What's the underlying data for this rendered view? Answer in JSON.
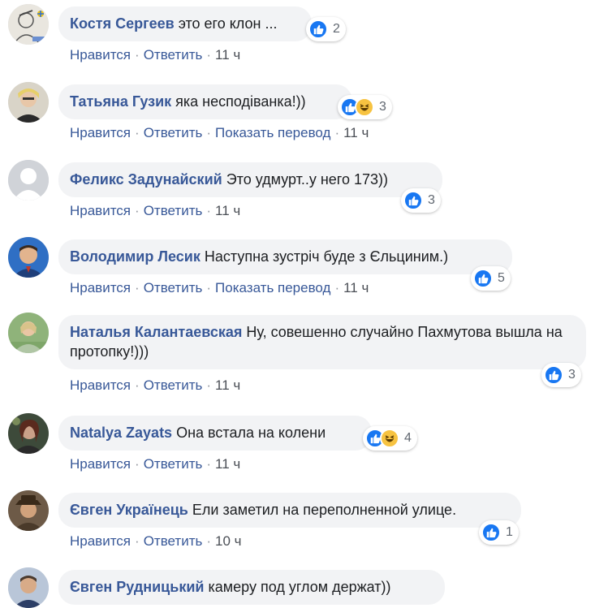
{
  "actions": {
    "like": "Нравится",
    "reply": "Ответить",
    "translate": "Показать перевод",
    "separator": "·"
  },
  "colors": {
    "link": "#385898",
    "bubble": "#f2f3f5",
    "like": "#1877f2",
    "haha": "#f7c341"
  },
  "comments": [
    {
      "author": "Костя Сергеев",
      "text": "это его клон ...",
      "reactions": [
        "like-icon"
      ],
      "count": "2",
      "translate": false,
      "time": "11 ч"
    },
    {
      "author": "Татьяна Гузик",
      "text": "яка несподіванка!))",
      "reactions": [
        "like-icon",
        "haha-icon"
      ],
      "count": "3",
      "translate": true,
      "time": "11 ч"
    },
    {
      "author": "Феликс Задунайский",
      "text": "Это удмурт..у него 173))",
      "reactions": [
        "like-icon"
      ],
      "count": "3",
      "translate": false,
      "time": "11 ч"
    },
    {
      "author": "Володимир Лесик",
      "text": "Наступна зустріч буде з Єльциним.)",
      "reactions": [
        "like-icon"
      ],
      "count": "5",
      "translate": true,
      "time": "11 ч"
    },
    {
      "author": "Наталья Калантаевская",
      "text": "Ну, совешенно случайно Пахмутова вышла на протопку!)))",
      "reactions": [
        "like-icon"
      ],
      "count": "3",
      "translate": false,
      "time": "11 ч"
    },
    {
      "author": "Natalya Zayats",
      "text": "Она встала на колени",
      "reactions": [
        "like-icon",
        "haha-icon"
      ],
      "count": "4",
      "translate": false,
      "time": "11 ч"
    },
    {
      "author": "Євген Українець",
      "text": "Ели заметил на переполненной улице.",
      "reactions": [
        "like-icon"
      ],
      "count": "1",
      "translate": false,
      "time": "10 ч"
    },
    {
      "author": "Євген Рудницький",
      "text": "камеру под углом держат))",
      "reactions": [],
      "count": "",
      "translate": false,
      "time": ""
    }
  ]
}
